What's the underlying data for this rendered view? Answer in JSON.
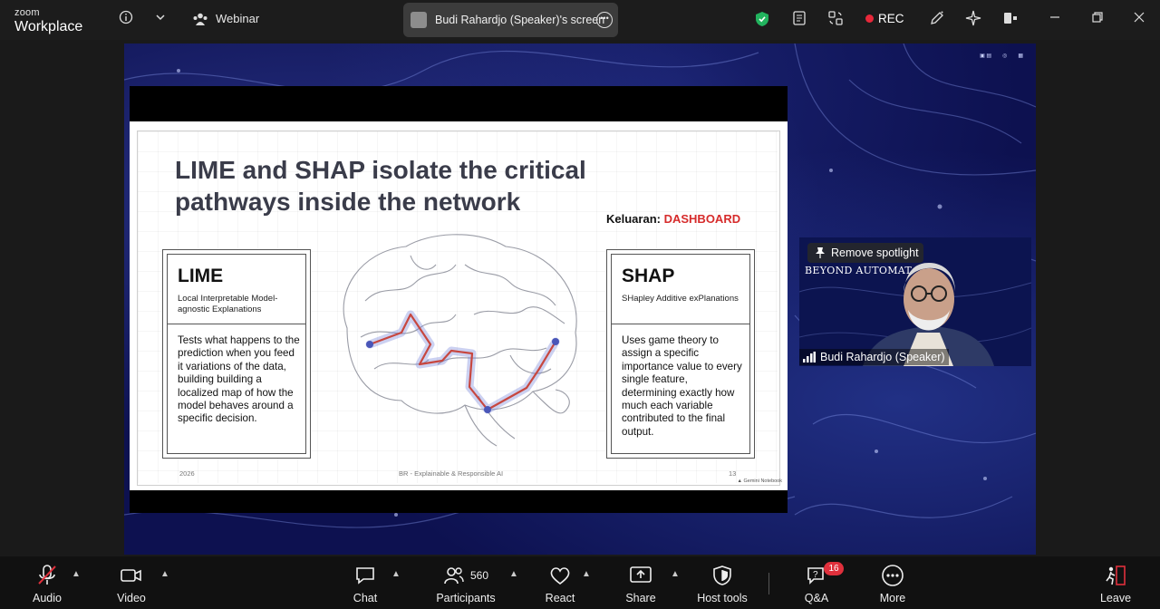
{
  "app": {
    "brand_small": "zoom",
    "brand_big": "Workplace"
  },
  "titlebar": {
    "webinar_label": "Webinar",
    "share_label": "Budi Rahardjo (Speaker)'s screen",
    "rec_label": "REC"
  },
  "slide": {
    "title": "LIME and SHAP isolate the critical pathways inside the network",
    "keluaran_label": "Keluaran:",
    "keluaran_value": "DASHBOARD",
    "lime": {
      "title": "LIME",
      "subtitle": "Local Interpretable Model-agnostic Explanations",
      "body": "Tests what happens to the prediction when you feed it variations of the data, building building a localized map of how the model behaves around a specific decision."
    },
    "shap": {
      "title": "SHAP",
      "subtitle": "SHapley Additive exPlanations",
      "body": "Uses game theory to assign a specific importance value to every single feature, determining exactly how much each variable contributed to the final output."
    },
    "footer_year": "2026",
    "footer_center": "BR - Explainable & Responsible AI",
    "footer_page": "13",
    "footer_credit": "Gemini Notebook"
  },
  "speaker": {
    "spotlight_label": "Remove spotlight",
    "banner_text": "BEYOND AUTOMAT",
    "name": "Budi Rahardjo (Speaker)"
  },
  "toolbar": {
    "audio": "Audio",
    "video": "Video",
    "chat": "Chat",
    "participants": "Participants",
    "participants_count": "560",
    "react": "React",
    "share": "Share",
    "host_tools": "Host tools",
    "qa": "Q&A",
    "qa_badge": "16",
    "more": "More",
    "leave": "Leave"
  },
  "colors": {
    "rec_dot": "#e8283a",
    "shield": "#22b35e",
    "badge": "#e0303c",
    "dashboard_red": "#d62b2b"
  }
}
